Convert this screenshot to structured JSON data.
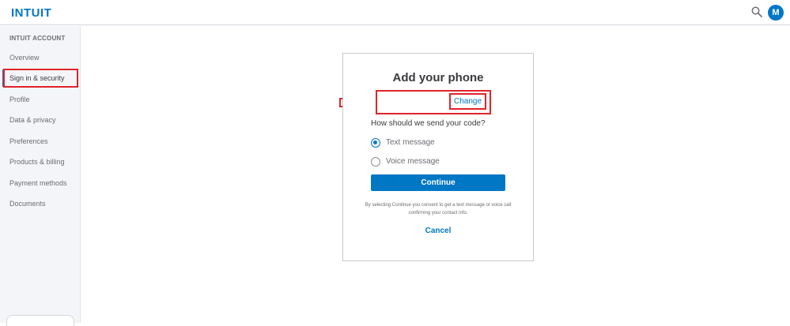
{
  "header": {
    "logo": "INTUIT",
    "search_icon": "search-icon",
    "avatar_initial": "M"
  },
  "sidebar": {
    "heading": "INTUIT ACCOUNT",
    "items": [
      {
        "label": "Overview"
      },
      {
        "label": "Sign in & security"
      },
      {
        "label": "Profile"
      },
      {
        "label": "Data & privacy"
      },
      {
        "label": "Preferences"
      },
      {
        "label": "Products & billing"
      },
      {
        "label": "Payment methods"
      },
      {
        "label": "Documents"
      }
    ],
    "active_index": 1
  },
  "dialog": {
    "title": "Add your phone",
    "phone_value": "",
    "change_label": "Change",
    "question": "How should we send your code?",
    "options": [
      {
        "label": "Text message",
        "checked": true
      },
      {
        "label": "Voice message",
        "checked": false
      }
    ],
    "continue_label": "Continue",
    "consent_text": "By selecting Continue you consent to get a text message or voice call confirming your contact info.",
    "cancel_label": "Cancel"
  },
  "colors": {
    "brand": "#0077c5",
    "highlight": "#e1232a"
  }
}
